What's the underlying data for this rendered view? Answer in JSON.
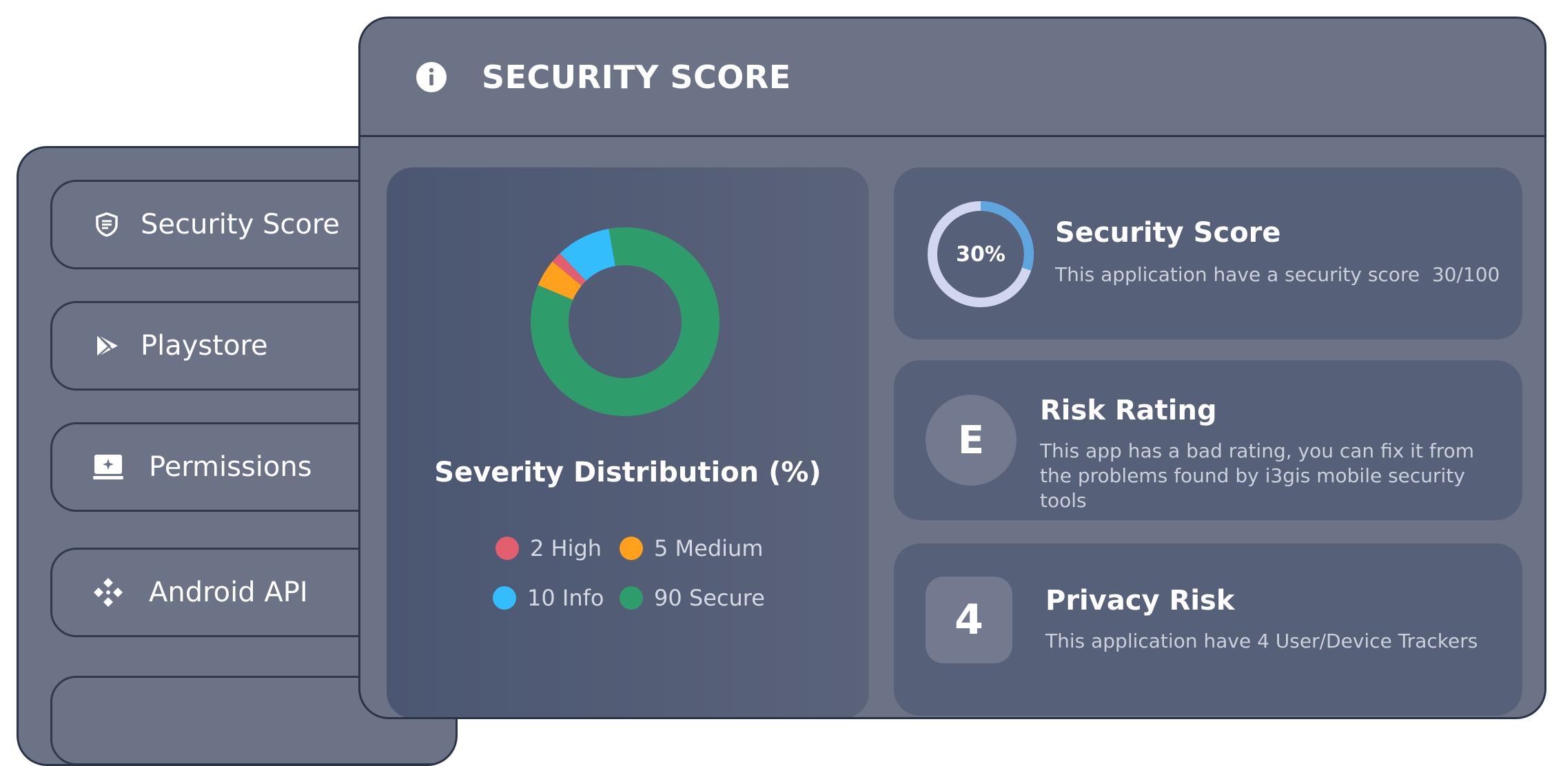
{
  "sidebar": {
    "items": [
      {
        "label": "Security Score",
        "icon": "shield-icon"
      },
      {
        "label": "Playstore",
        "icon": "play-store-icon"
      },
      {
        "label": "Permissions",
        "icon": "monitor-sparkle-icon"
      },
      {
        "label": "Android API",
        "icon": "api-icon"
      },
      {
        "label": "",
        "icon": ""
      }
    ]
  },
  "header": {
    "title": "SECURITY SCORE",
    "icon": "info-icon"
  },
  "severity": {
    "title": "Severity Distribution (%)",
    "legend": [
      {
        "label": "2 High",
        "color": "#e15f6f"
      },
      {
        "label": "5 Medium",
        "color": "#ffa11c"
      },
      {
        "label": "10 Info",
        "color": "#34bdfd"
      },
      {
        "label": "90 Secure",
        "color": "#2e9d6b"
      }
    ]
  },
  "chart_data": {
    "type": "pie",
    "title": "Severity Distribution (%)",
    "categories": [
      "High",
      "Medium",
      "Info",
      "Secure"
    ],
    "values": [
      2,
      5,
      10,
      90
    ],
    "colors": [
      "#e15f6f",
      "#ffa11c",
      "#34bdfd",
      "#2e9d6b"
    ],
    "legend_position": "bottom"
  },
  "score_card": {
    "percent_text": "30%",
    "percent": 30,
    "title": "Security Score",
    "description": "This application have a security score  30/100",
    "ring_color": "#5fa6e0",
    "track_color": "#d3d6ef"
  },
  "risk_card": {
    "grade": "E",
    "title": "Risk Rating",
    "description": "This app has a bad rating, you can fix it from the problems found by i3gis mobile security tools"
  },
  "privacy_card": {
    "count": "4",
    "title": "Privacy Risk",
    "description": "This application have 4 User/Device Trackers"
  }
}
